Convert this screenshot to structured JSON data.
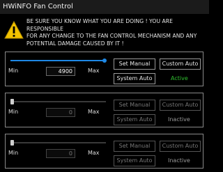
{
  "window": {
    "title": "HWiNFO Fan Control"
  },
  "warning": {
    "icon": "warning-icon",
    "line1": "BE SURE YOU KNOW WHAT YOU ARE DOING ! YOU ARE RESPONSIBLE",
    "line2": "FOR ANY CHANGE TO THE FAN CONTROL MECHANISM AND ANY",
    "line3": "POTENTIAL DAMAGE CAUSED BY IT !"
  },
  "panels": [
    {
      "min_label": "Min",
      "max_label": "Max",
      "value": "4900",
      "slider_level": 1.0,
      "set_manual": "Set Manual",
      "custom_auto": "Custom Auto",
      "system_auto": "System Auto",
      "status": "Active",
      "status_color": "#2fbf2f",
      "enabled": true
    },
    {
      "min_label": "Min",
      "max_label": "Max",
      "value": "0",
      "slider_level": 0.0,
      "set_manual": "Set Manual",
      "custom_auto": "Custom Auto",
      "system_auto": "System Auto",
      "status": "Inactive",
      "status_color": "#9a9a9a",
      "enabled": false
    },
    {
      "min_label": "Min",
      "max_label": "Max",
      "value": "0",
      "slider_level": 0.0,
      "set_manual": "Set Manual",
      "custom_auto": "Custom Auto",
      "system_auto": "System Auto",
      "status": "Inactive",
      "status_color": "#9a9a9a",
      "enabled": false
    }
  ],
  "colors": {
    "accent": "#1e88e5"
  }
}
